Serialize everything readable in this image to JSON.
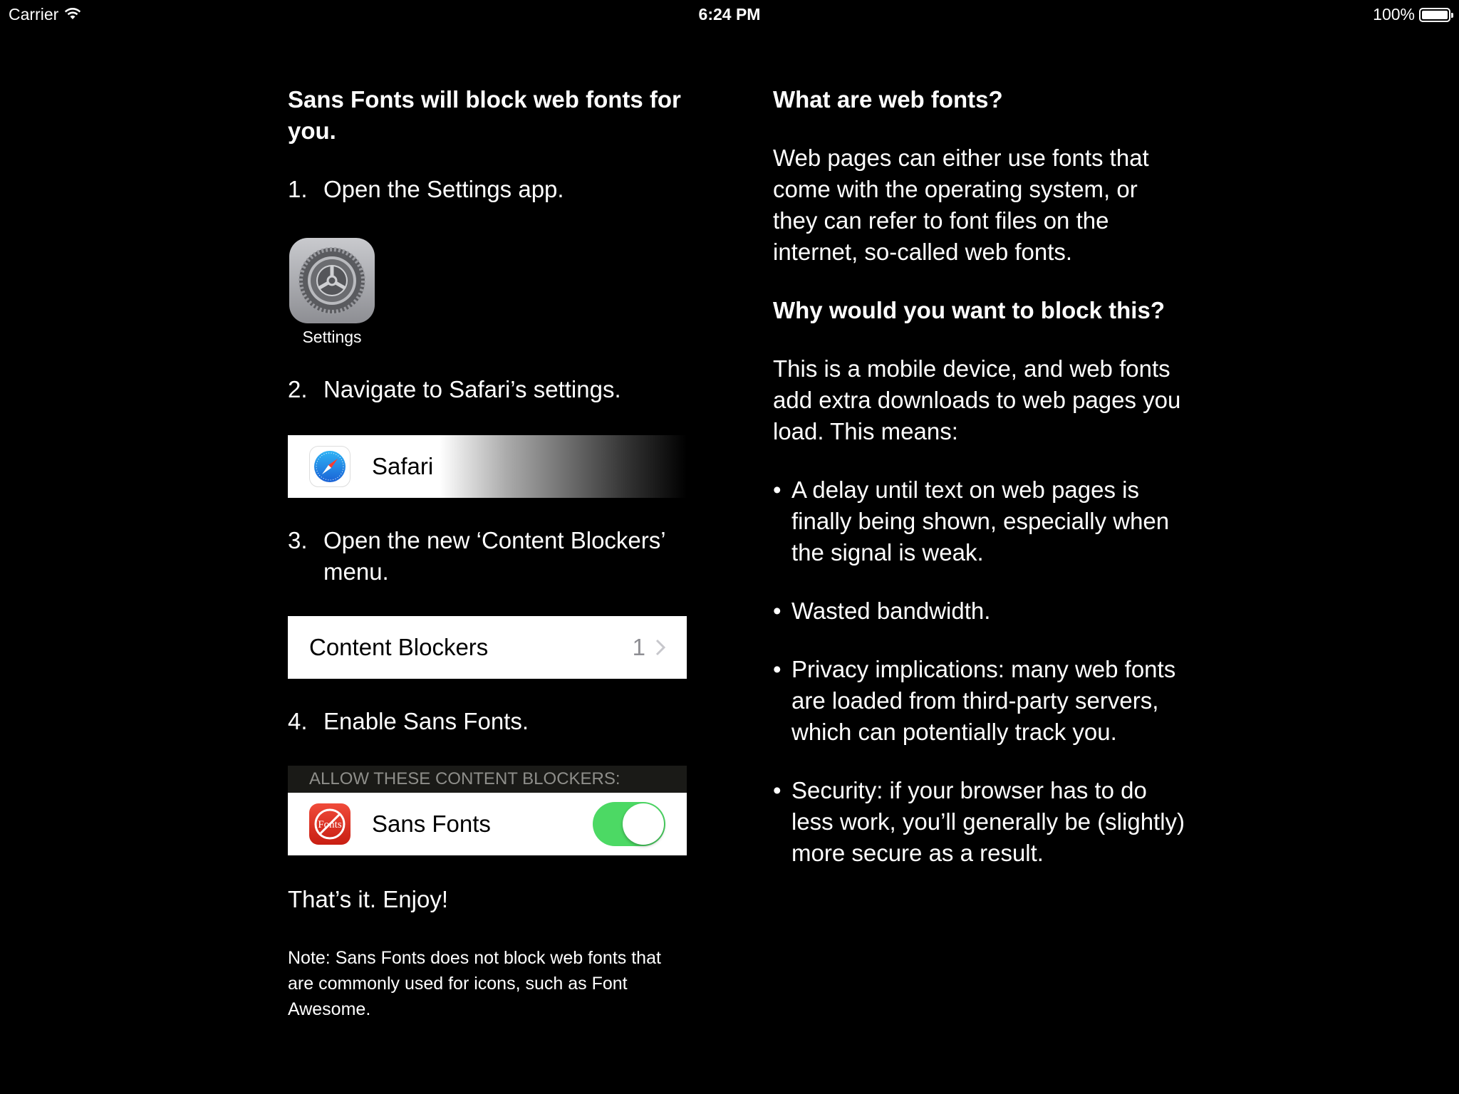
{
  "status_bar": {
    "carrier": "Carrier",
    "time": "6:24 PM",
    "battery": "100%",
    "battery_level": 1.0
  },
  "left": {
    "heading": "Sans Fonts will block web fonts for you.",
    "steps": [
      {
        "num": "1.",
        "text": "Open the Settings app."
      },
      {
        "num": "2.",
        "text": "Navigate to Safari’s settings."
      },
      {
        "num": "3.",
        "text": "Open the new ‘Content Blockers’ menu."
      },
      {
        "num": "4.",
        "text": "Enable Sans Fonts."
      }
    ],
    "settings_app_label": "Settings",
    "safari_row_label": "Safari",
    "content_blockers_row": {
      "label": "Content Blockers",
      "count": "1"
    },
    "allow_header": "ALLOW THESE CONTENT BLOCKERS:",
    "sans_fonts_row": {
      "label": "Sans Fonts",
      "icon_text": "Fonts",
      "enabled": true
    },
    "enjoy": "That’s it. Enjoy!",
    "note": "Note: Sans Fonts does not block web fonts that are commonly used for icons, such as Font Awesome."
  },
  "right": {
    "heading1": "What are web fonts?",
    "para1": "Web pages can either use fonts that come with the operating system, or they can refer to font files on the internet, so-called web fonts.",
    "heading2": "Why would you want to block this?",
    "para2": "This is a mobile device, and web fonts add extra downloads to web pages you load. This means:",
    "bullets": [
      "A delay until text on web pages is finally being shown, especially when the signal is weak.",
      "Wasted bandwidth.",
      "Privacy implications: many web fonts are loaded from third-party servers, which can potentially track you.",
      "Security: if your browser has to do less work, you’ll generally be (slightly) more secure as a result."
    ],
    "bullet_symbol": "•"
  },
  "colors": {
    "background": "#000000",
    "toggle_on": "#4cd964",
    "sans_fonts_icon": "#d9281a"
  },
  "icons": [
    "wifi-icon",
    "battery-icon",
    "settings-gear-icon",
    "safari-compass-icon",
    "chevron-right-icon",
    "sans-fonts-app-icon"
  ]
}
